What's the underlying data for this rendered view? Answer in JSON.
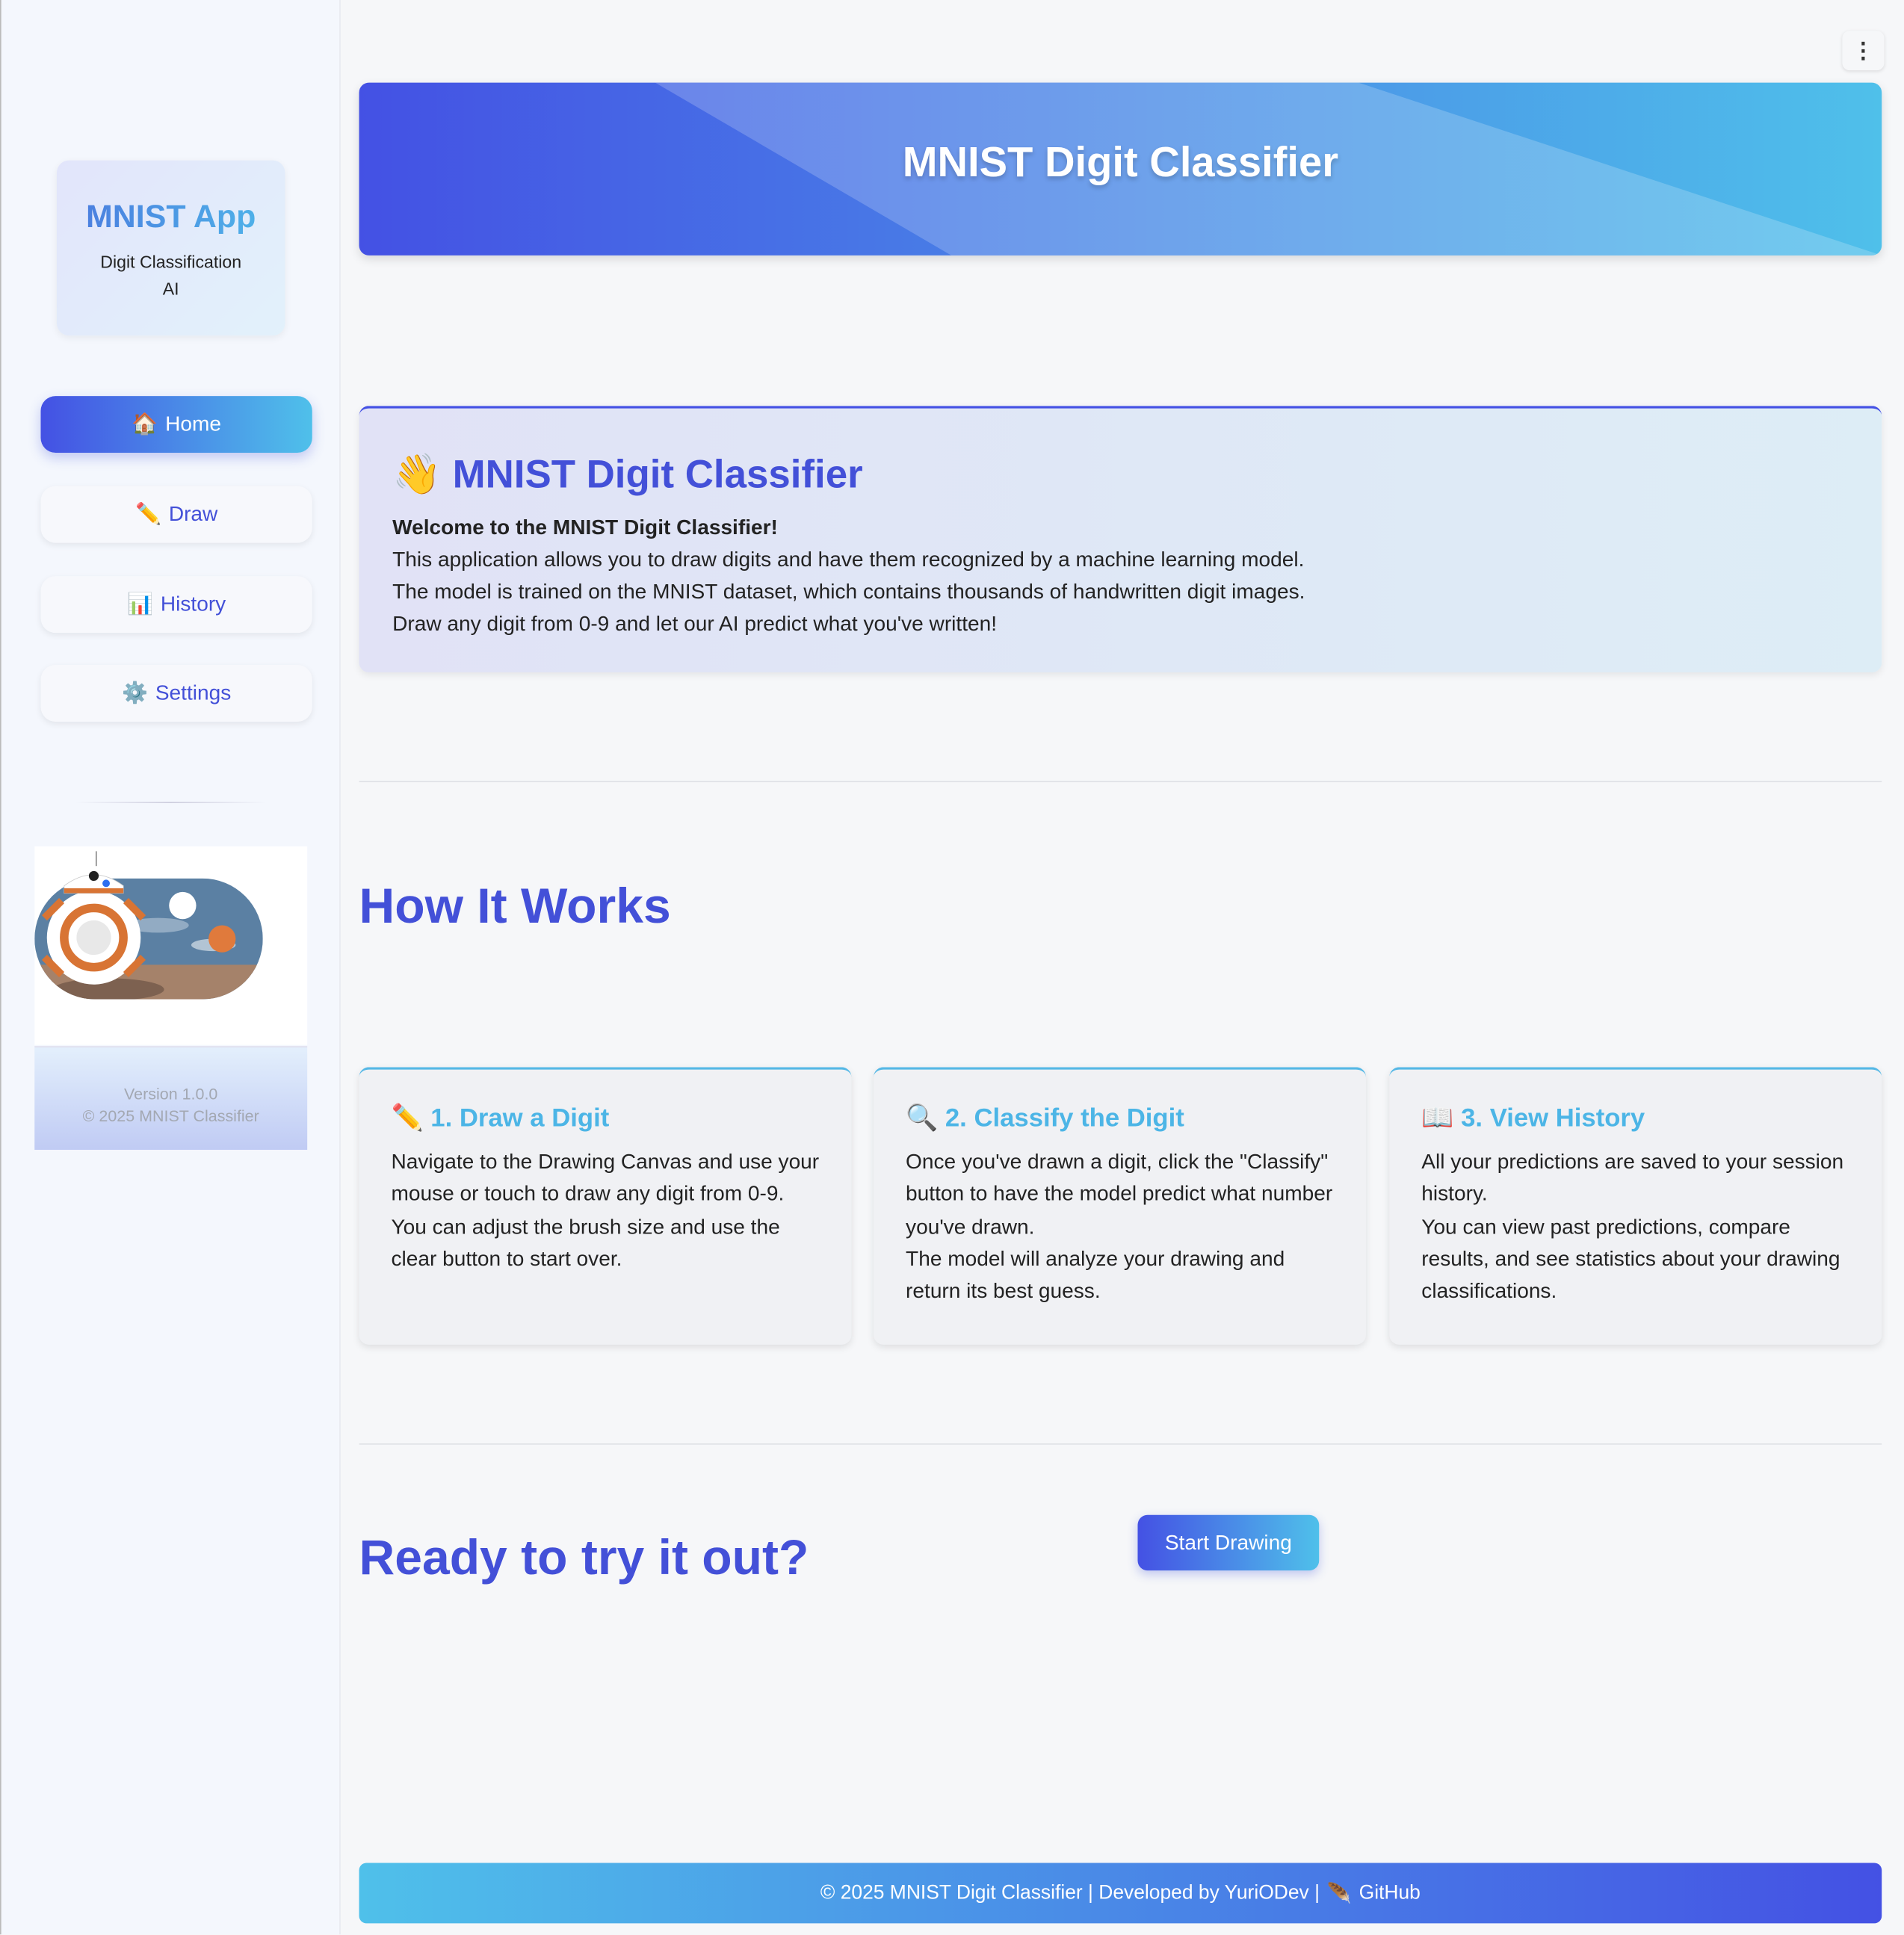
{
  "sidebar": {
    "logo_title": "MNIST App",
    "logo_subtitle": "Digit Classification AI",
    "nav": [
      {
        "icon": "🏠",
        "label": "Home"
      },
      {
        "icon": "✏️",
        "label": "Draw"
      },
      {
        "icon": "📊",
        "label": "History"
      },
      {
        "icon": "⚙️",
        "label": "Settings"
      }
    ],
    "version": "Version 1.0.0",
    "copyright": "© 2025 MNIST Classifier"
  },
  "menu_icon": "⋮",
  "banner": {
    "title": "MNIST Digit Classifier"
  },
  "welcome": {
    "icon": "👋",
    "title": "MNIST Digit Classifier",
    "bold": "Welcome to the MNIST Digit Classifier!",
    "lines": [
      "This application allows you to draw digits and have them recognized by a machine learning model.",
      "The model is trained on the MNIST dataset, which contains thousands of handwritten digit images.",
      "Draw any digit from 0-9 and let our AI predict what you've written!"
    ]
  },
  "how": {
    "title": "How It Works",
    "cards": [
      {
        "icon": "✏️",
        "title": "1. Draw a Digit",
        "p1": "Navigate to the Drawing Canvas and use your mouse or touch to draw any digit from 0-9.",
        "p2": "You can adjust the brush size and use the clear button to start over."
      },
      {
        "icon": "🔍",
        "title": "2. Classify the Digit",
        "p1": "Once you've drawn a digit, click the \"Classify\" button to have the model predict what number you've drawn.",
        "p2": "The model will analyze your drawing and return its best guess."
      },
      {
        "icon": "📖",
        "title": "3. View History",
        "p1": "All your predictions are saved to your session history.",
        "p2": "You can view past predictions, compare results, and see statistics about your drawing classifications."
      }
    ]
  },
  "cta": {
    "title": "Ready to try it out?",
    "button": "Start Drawing"
  },
  "footer": {
    "text": "© 2025 MNIST Digit Classifier | Developed by YuriODev |",
    "icon": "🪶",
    "link": "GitHub"
  }
}
